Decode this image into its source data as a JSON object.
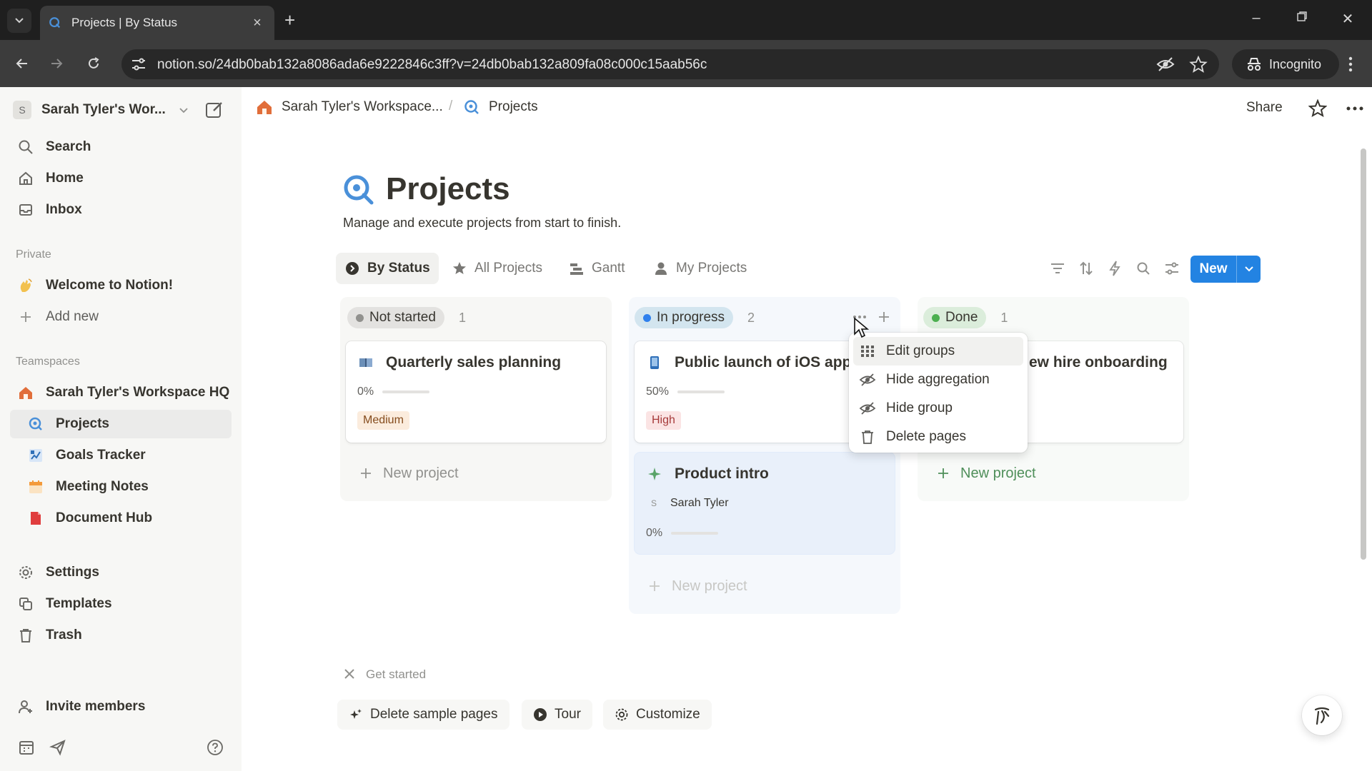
{
  "browser": {
    "tab_title": "Projects | By Status",
    "url": "notion.so/24db0bab132a8086ada6e9222846c3ff?v=24db0bab132a809fa08c000c15aab56c",
    "incognito_label": "Incognito"
  },
  "sidebar": {
    "workspace_initial": "S",
    "workspace_name": "Sarah Tyler's Wor...",
    "top_items": [
      {
        "label": "Search",
        "icon": "search-icon"
      },
      {
        "label": "Home",
        "icon": "home-icon"
      },
      {
        "label": "Inbox",
        "icon": "inbox-icon"
      }
    ],
    "private_label": "Private",
    "private_items": [
      {
        "label": "Welcome to Notion!",
        "icon": "wave-emoji-icon"
      },
      {
        "label": "Add new",
        "icon": "plus-icon"
      }
    ],
    "teamspaces_label": "Teamspaces",
    "teamspace_items": [
      {
        "label": "Sarah Tyler's Workspace HQ",
        "icon": "house-icon"
      },
      {
        "label": "Projects",
        "icon": "projects-icon"
      },
      {
        "label": "Goals Tracker",
        "icon": "goals-icon"
      },
      {
        "label": "Meeting Notes",
        "icon": "calendar-icon"
      },
      {
        "label": "Document Hub",
        "icon": "document-icon"
      }
    ],
    "bottom_items": [
      {
        "label": "Settings",
        "icon": "gear-icon"
      },
      {
        "label": "Templates",
        "icon": "templates-icon"
      },
      {
        "label": "Trash",
        "icon": "trash-icon"
      }
    ],
    "invite_label": "Invite members"
  },
  "topbar": {
    "breadcrumb_workspace": "Sarah Tyler's Workspace...",
    "breadcrumb_page": "Projects",
    "share_label": "Share"
  },
  "page": {
    "title": "Projects",
    "description": "Manage and execute projects from start to finish."
  },
  "views": [
    {
      "label": "By Status",
      "icon": "status-icon",
      "active": true
    },
    {
      "label": "All Projects",
      "icon": "star-icon",
      "active": false
    },
    {
      "label": "Gantt",
      "icon": "gantt-icon",
      "active": false
    },
    {
      "label": "My Projects",
      "icon": "person-icon",
      "active": false
    }
  ],
  "new_button_label": "New",
  "board": {
    "new_project_label": "New project",
    "columns": [
      {
        "name": "Not started",
        "count": "1",
        "color": "#91918e",
        "bg": "#f7f7f5",
        "pill_bg": "#e3e2e0",
        "cards": [
          {
            "title": "Quarterly sales planning",
            "progress": 0,
            "progress_label": "0%",
            "priority": "Medium",
            "priority_bg": "#fbecdd",
            "priority_color": "#854c1d"
          }
        ]
      },
      {
        "name": "In progress",
        "count": "2",
        "color": "#2f80ed",
        "bg": "#f5f8fc",
        "pill_bg": "#d3e5ef",
        "cards": [
          {
            "title": "Public launch of iOS app",
            "progress": 50,
            "progress_label": "50%",
            "priority": "High",
            "priority_bg": "#fbe4e4",
            "priority_color": "#a63a3a"
          },
          {
            "title": "Product intro",
            "assignee_initial": "S",
            "assignee": "Sarah Tyler",
            "progress": 0,
            "progress_label": "0%"
          }
        ]
      },
      {
        "name": "Done",
        "count": "1",
        "color": "#4caf50",
        "bg": "#f8faf8",
        "pill_bg": "#dbeddb",
        "cards": [
          {
            "title": "ew hire onboarding"
          }
        ]
      }
    ]
  },
  "context_menu": {
    "items": [
      {
        "label": "Edit groups",
        "icon": "grid-icon"
      },
      {
        "label": "Hide aggregation",
        "icon": "eye-slash-icon"
      },
      {
        "label": "Hide group",
        "icon": "eye-slash-icon"
      },
      {
        "label": "Delete pages",
        "icon": "trash-icon"
      }
    ]
  },
  "get_started": {
    "label": "Get started",
    "buttons": [
      {
        "label": "Delete sample pages",
        "icon": "sparkle-icon"
      },
      {
        "label": "Tour",
        "icon": "play-icon"
      },
      {
        "label": "Customize",
        "icon": "gear-icon"
      }
    ]
  }
}
